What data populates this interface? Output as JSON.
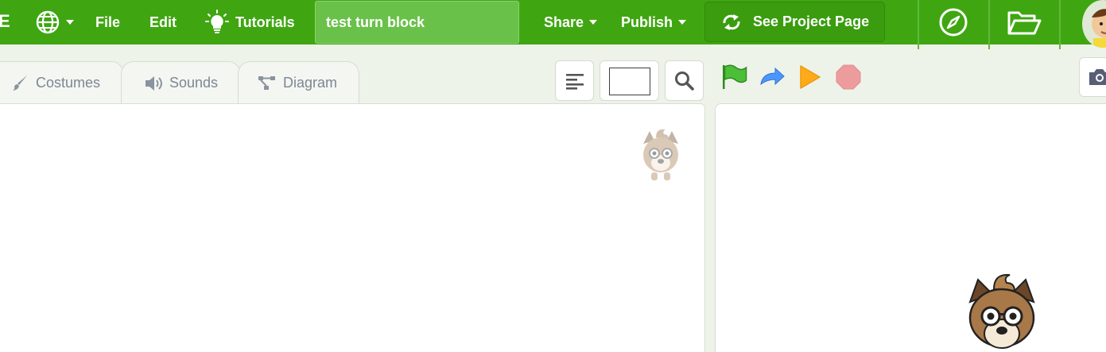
{
  "menubar": {
    "logo_text": "E",
    "globe_icon": "globe-icon",
    "file_label": "File",
    "edit_label": "Edit",
    "tutorials_label": "Tutorials",
    "project_title": "test turn block",
    "share_label": "Share",
    "publish_label": "Publish",
    "see_project_label": "See Project Page",
    "explore_icon": "compass-icon",
    "my_stuff_icon": "folder-icon",
    "brand_color": "#3fa611"
  },
  "editor_tabs": [
    {
      "label": "Costumes",
      "icon": "brush-icon"
    },
    {
      "label": "Sounds",
      "icon": "speaker-icon"
    },
    {
      "label": "Diagram",
      "icon": "diagram-icon"
    }
  ],
  "toolbar": {
    "align_icon": "align-left-icon",
    "zoom_box": "",
    "search_icon": "search-icon"
  },
  "stage_controls": {
    "green_flag": "green-flag-icon",
    "step": "step-arrow-icon",
    "run": "play-triangle-icon",
    "stop": "stop-octagon-icon",
    "camera": "camera-icon"
  }
}
